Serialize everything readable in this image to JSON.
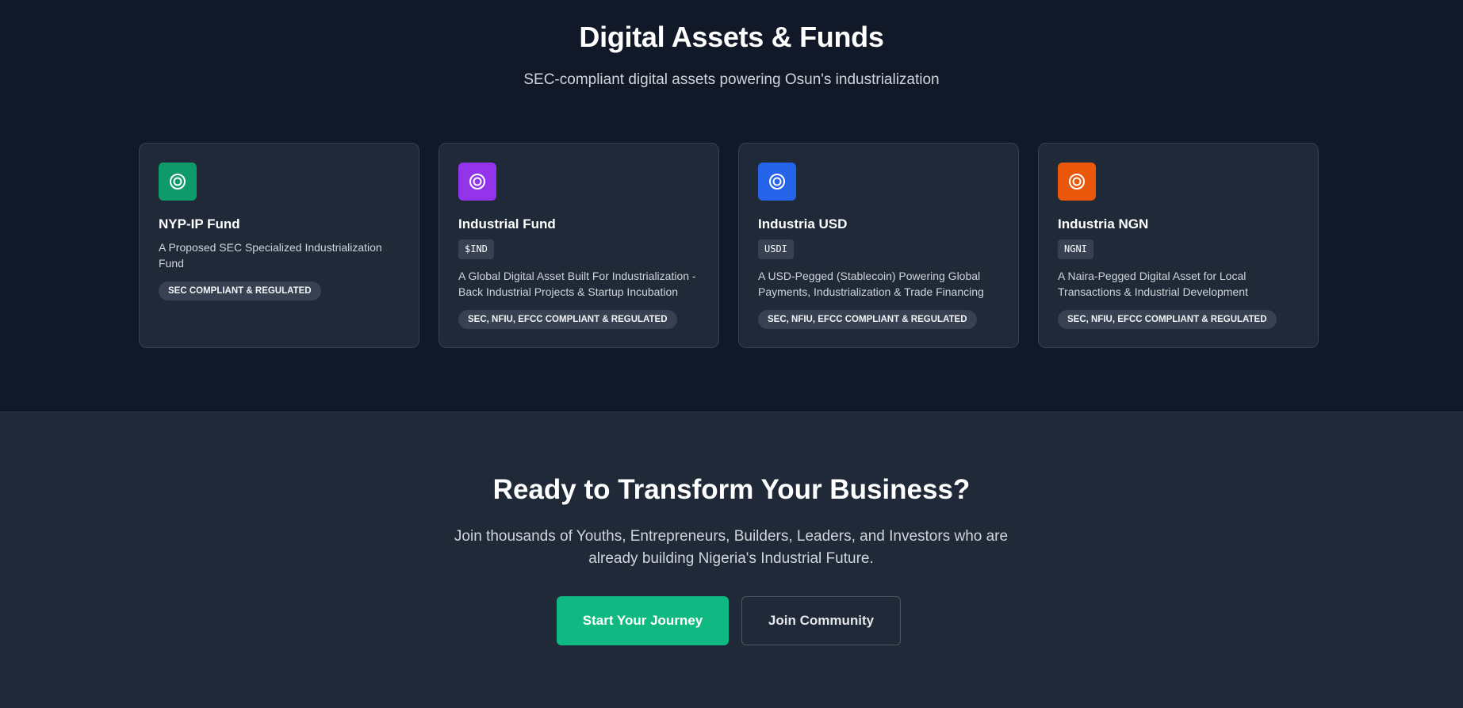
{
  "assets": {
    "title": "Digital Assets & Funds",
    "subtitle": "SEC-compliant digital assets powering Osun's industrialization",
    "cards": [
      {
        "icon": "target-icon",
        "icon_color": "#0e9a6a",
        "title": "NYP-IP Fund",
        "ticker": "",
        "description": "A Proposed SEC Specialized Industrialization Fund",
        "badge": "SEC COMPLIANT & REGULATED"
      },
      {
        "icon": "target-icon",
        "icon_color": "#9333ea",
        "title": "Industrial Fund",
        "ticker": "$IND",
        "description": "A Global Digital Asset Built For Industrialization - Back Industrial Projects & Startup Incubation",
        "badge": "SEC, NFIU, EFCC COMPLIANT & REGULATED"
      },
      {
        "icon": "target-icon",
        "icon_color": "#2563eb",
        "title": "Industria USD",
        "ticker": "USDI",
        "description": "A USD-Pegged (Stablecoin) Powering Global Payments, Industrialization & Trade Financing",
        "badge": "SEC, NFIU, EFCC COMPLIANT & REGULATED"
      },
      {
        "icon": "target-icon",
        "icon_color": "#ea580c",
        "title": "Industria NGN",
        "ticker": "NGNI",
        "description": "A Naira-Pegged Digital Asset for Local Transactions & Industrial Development",
        "badge": "SEC, NFIU, EFCC COMPLIANT & REGULATED"
      }
    ]
  },
  "cta": {
    "title": "Ready to Transform Your Business?",
    "text": "Join thousands of Youths, Entrepreneurs, Builders, Leaders, and Investors who are already building Nigeria's Industrial Future.",
    "primary_button": "Start Your Journey",
    "secondary_button": "Join Community"
  },
  "colors": {
    "page_bg": "#111827",
    "card_bg": "#1f2937",
    "accent_green": "#10b981"
  }
}
